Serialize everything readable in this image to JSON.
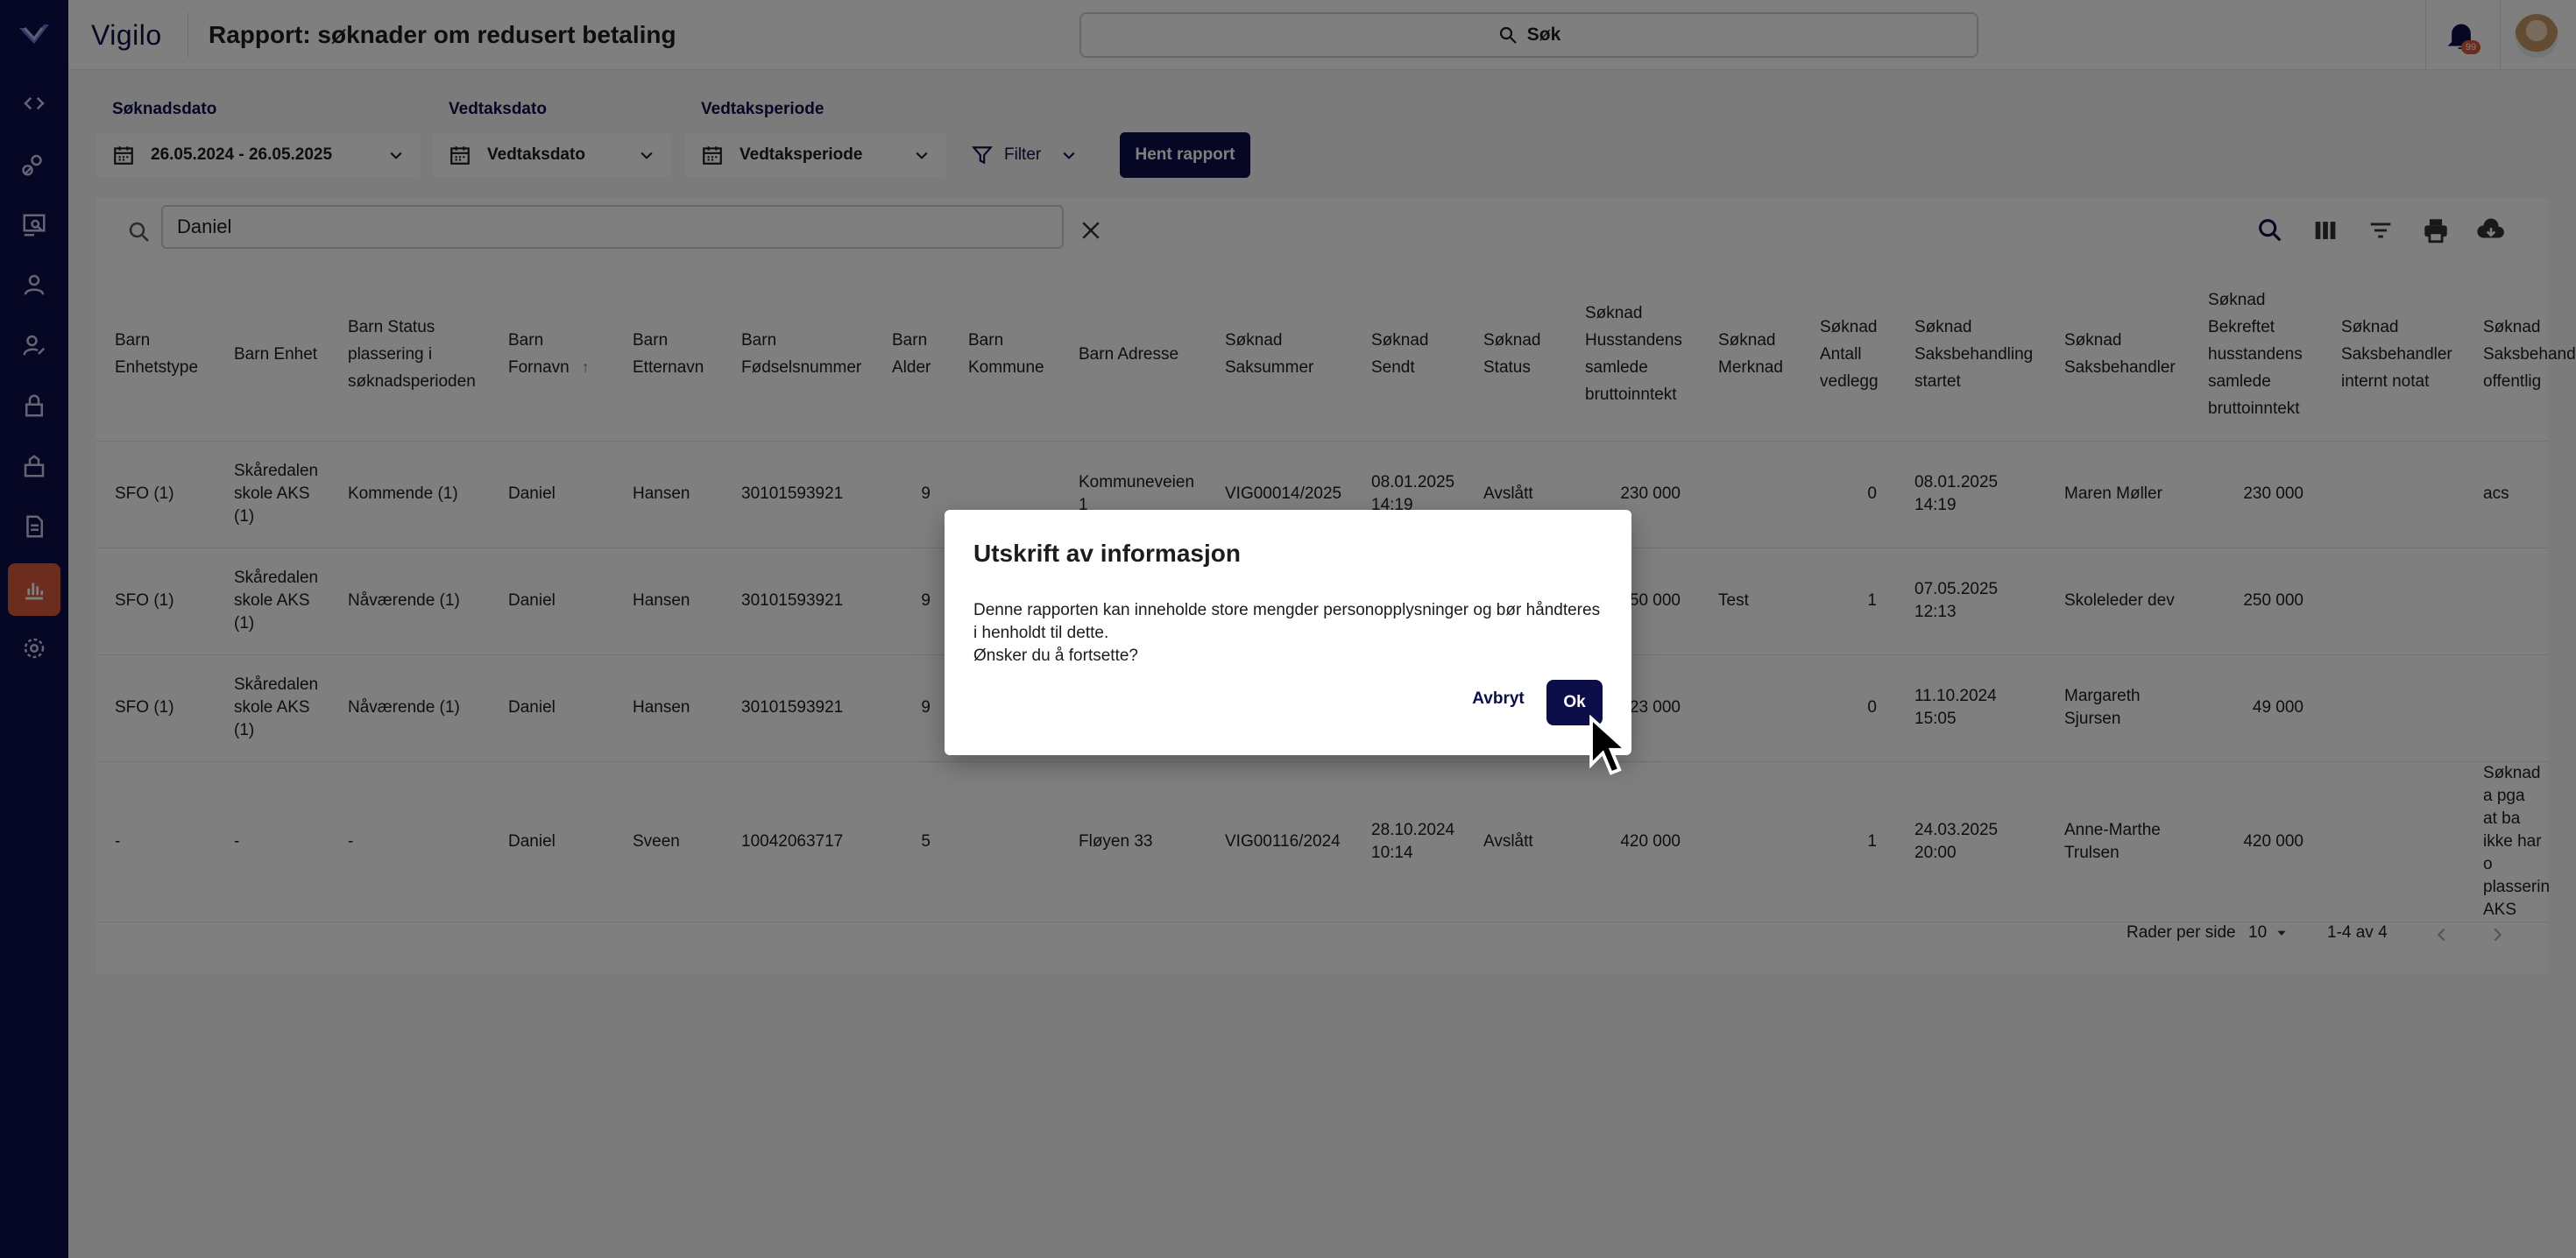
{
  "app": {
    "brand": "Vigilo",
    "page_title": "Rapport: søknader om redusert betaling"
  },
  "topbar": {
    "search_label": "Søk",
    "notification_count": "99"
  },
  "sidebar": {
    "items": [
      "code-icon",
      "user-search-icon",
      "screen-search-icon",
      "person-icon",
      "person-edit-icon",
      "lock-icon",
      "building-icon",
      "document-icon",
      "chart-icon",
      "gear-icon"
    ],
    "active": "chart-icon"
  },
  "filters": {
    "soknadsdato_label": "Søknadsdato",
    "soknadsdato_value": "26.05.2024 - 26.05.2025",
    "vedtaksdato_label": "Vedtaksdato",
    "vedtaksdato_value": "Vedtaksdato",
    "vedtaksperiode_label": "Vedtaksperiode",
    "vedtaksperiode_value": "Vedtaksperiode",
    "filter_label": "Filter",
    "fetch_button": "Hent rapport"
  },
  "table_search": {
    "value": "Daniel"
  },
  "columns": [
    "Barn Enhetstype",
    "Barn Enhet",
    "Barn Status plassering i søknadsperioden",
    "Barn Fornavn",
    "Barn Etternavn",
    "Barn Fødselsnummer",
    "Barn Alder",
    "Barn Kommune",
    "Barn Adresse",
    "Søknad Saksummer",
    "Søknad Sendt",
    "Søknad Status",
    "Søknad Husstandens samlede bruttoinntekt",
    "Søknad Merknad",
    "Søknad Antall vedlegg",
    "Søknad Saksbehandling startet",
    "Søknad Saksbehandler",
    "Søknad Bekreftet husstandens samlede bruttoinntekt",
    "Søknad Saksbehandler internt notat",
    "Søknad Saksbehandler offentlig"
  ],
  "rows": [
    [
      "SFO (1)",
      "Skåredalen skole AKS (1)",
      "Kommende (1)",
      "Daniel",
      "Hansen",
      "30101593921",
      "9",
      "",
      "Kommuneveien 1",
      "VIG00014/2025",
      "08.01.2025 14:19",
      "Avslått",
      "230 000",
      "",
      "0",
      "08.01.2025 14:19",
      "Maren Møller",
      "230 000",
      "",
      "acs"
    ],
    [
      "SFO (1)",
      "Skåredalen skole AKS (1)",
      "Nåværende (1)",
      "Daniel",
      "Hansen",
      "30101593921",
      "9",
      "",
      "",
      "",
      "",
      "",
      "250 000",
      "Test",
      "1",
      "07.05.2025 12:13",
      "Skoleleder dev",
      "250 000",
      "",
      ""
    ],
    [
      "SFO (1)",
      "Skåredalen skole AKS (1)",
      "Nåværende (1)",
      "Daniel",
      "Hansen",
      "30101593921",
      "9",
      "",
      "",
      "",
      "",
      "",
      "23 000",
      "",
      "0",
      "11.10.2024 15:05",
      "Margareth Sjursen",
      "49 000",
      "",
      ""
    ],
    [
      "-",
      "-",
      "-",
      "Daniel",
      "Sveen",
      "10042063717",
      "5",
      "",
      "Fløyen 33",
      "VIG00116/2024",
      "28.10.2024 10:14",
      "Avslått",
      "420 000",
      "",
      "1",
      "24.03.2025 20:00",
      "Anne-Marthe Trulsen",
      "420 000",
      "",
      "Søknad a pga at ba ikke har o plasserin AKS"
    ]
  ],
  "pagination": {
    "rows_per_page_label": "Rader per side",
    "rows_per_page": "10",
    "range": "1-4 av 4"
  },
  "dialog": {
    "title": "Utskrift av informasjon",
    "line1": "Denne rapporten kan inneholde store mengder personopplysninger og bør håndteres i henholdt til dette.",
    "line2": "Ønsker du å fortsette?",
    "cancel": "Avbryt",
    "ok": "Ok"
  },
  "colors": {
    "brand": "#0c0e4a",
    "accent": "#d9583c"
  }
}
